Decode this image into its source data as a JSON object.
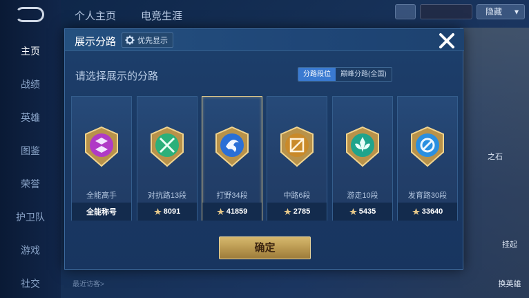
{
  "background": {
    "sidebar": [
      "主页",
      "战绩",
      "英雄",
      "图鉴",
      "荣誉",
      "护卫队",
      "游戏",
      "社交"
    ],
    "top_tabs": [
      "个人主页",
      "电竞生涯"
    ],
    "top_right_select": "隐藏",
    "visitors_label": "最近访客>",
    "right_buttons": [
      "挂起",
      "换英雄"
    ],
    "right_partial": "之石"
  },
  "modal": {
    "title": "展示分路",
    "priority_label": "优先显示",
    "subtitle": "请选择展示的分路",
    "tabs": [
      {
        "label": "分路段位",
        "active": true
      },
      {
        "label": "巅峰分路(全国)",
        "active": false
      }
    ],
    "cards": [
      {
        "name": "全能高手",
        "stat": "全能称号",
        "has_points_icon": false,
        "selected": false,
        "color": "#b03ac6"
      },
      {
        "name": "对抗路13段",
        "stat": "8091",
        "has_points_icon": true,
        "selected": false,
        "color": "#2bb07a"
      },
      {
        "name": "打野34段",
        "stat": "41859",
        "has_points_icon": true,
        "selected": true,
        "color": "#2a6fd6"
      },
      {
        "name": "中路6段",
        "stat": "2785",
        "has_points_icon": true,
        "selected": false,
        "color": "#c98a2a"
      },
      {
        "name": "游走10段",
        "stat": "5435",
        "has_points_icon": true,
        "selected": false,
        "color": "#1fa48c"
      },
      {
        "name": "发育路30段",
        "stat": "33640",
        "has_points_icon": true,
        "selected": false,
        "color": "#2a8fe0"
      }
    ],
    "confirm_label": "确定"
  },
  "colors": {
    "accent_blue": "#3a7ad1",
    "gold": "#d6b86e"
  }
}
